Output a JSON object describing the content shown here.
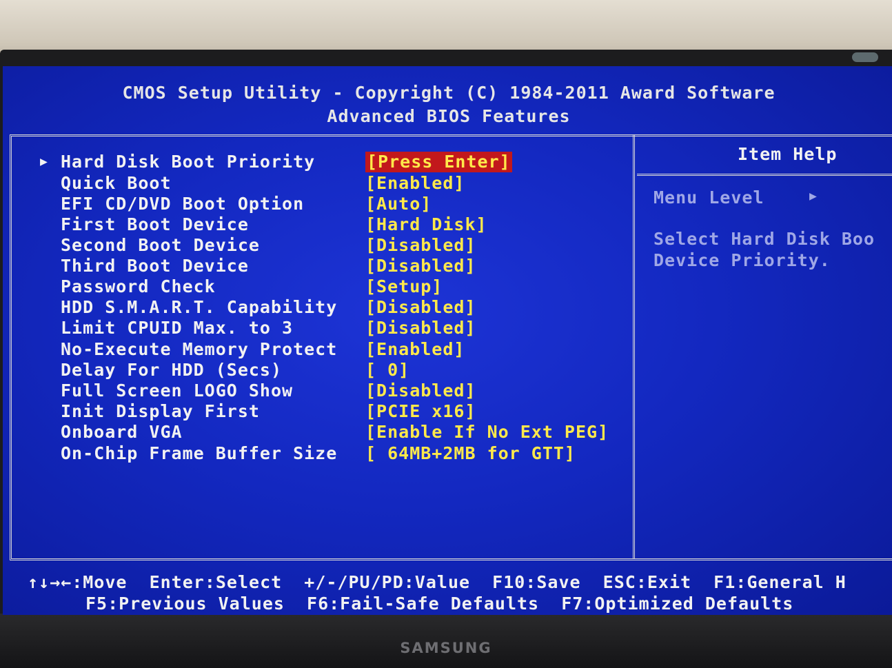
{
  "monitor": {
    "brand": "SAMSUNG"
  },
  "header": {
    "title": "CMOS Setup Utility - Copyright (C) 1984-2011 Award Software",
    "subtitle": "Advanced BIOS Features"
  },
  "settings": [
    {
      "label": "Hard Disk Boot Priority",
      "value": "[Press Enter]",
      "submenu_arrow": "▶",
      "selected": true
    },
    {
      "label": "Quick Boot",
      "value": "[Enabled]"
    },
    {
      "label": "EFI CD/DVD Boot Option",
      "value": "[Auto]"
    },
    {
      "label": "First Boot Device",
      "value": "[Hard Disk]"
    },
    {
      "label": "Second Boot Device",
      "value": "[Disabled]"
    },
    {
      "label": "Third Boot Device",
      "value": "[Disabled]"
    },
    {
      "label": "Password Check",
      "value": "[Setup]"
    },
    {
      "label": "HDD S.M.A.R.T. Capability",
      "value": "[Disabled]"
    },
    {
      "label": "Limit CPUID Max. to 3",
      "value": "[Disabled]"
    },
    {
      "label": "No-Execute Memory Protect",
      "value": "[Enabled]"
    },
    {
      "label": "Delay For HDD (Secs)",
      "value": "[ 0]"
    },
    {
      "label": "Full Screen LOGO Show",
      "value": "[Disabled]"
    },
    {
      "label": "Init Display First",
      "value": "[PCIE x16]"
    },
    {
      "label": "Onboard VGA",
      "value": "[Enable If No Ext PEG]"
    },
    {
      "label": "On-Chip Frame Buffer Size",
      "value": "[ 64MB+2MB for GTT]"
    }
  ],
  "item_help": {
    "title": "Item Help",
    "menu_level": "Menu Level",
    "menu_level_icon": "▶",
    "text_line1": "Select Hard Disk Boo",
    "text_line2": "Device Priority."
  },
  "footer": {
    "line1": "↑↓→←:Move  Enter:Select  +/-/PU/PD:Value  F10:Save  ESC:Exit  F1:General H",
    "line2": "F5:Previous Values  F6:Fail-Safe Defaults  F7:Optimized Defaults"
  },
  "colors": {
    "screen_bg": "#1328c0",
    "value_text": "#ffe94a",
    "highlight_bg": "#c2181c",
    "help_text": "#9fa7e6"
  }
}
